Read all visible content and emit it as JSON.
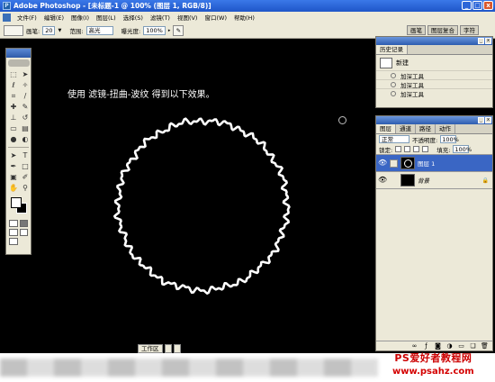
{
  "window": {
    "title": "Adobe Photoshop - [未标题-1 @ 100% (图层 1, RGB/8)]",
    "controls": [
      "_",
      "□",
      "x"
    ]
  },
  "menubar": {
    "items": [
      "文件(F)",
      "编辑(E)",
      "图像(I)",
      "图层(L)",
      "选择(S)",
      "滤镜(T)",
      "视图(V)",
      "窗口(W)",
      "帮助(H)"
    ]
  },
  "options": {
    "brush_label": "画笔:",
    "brush_size": "20",
    "range_label": "范围:",
    "range_value": "高光",
    "exposure_label": "曝光度:",
    "exposure_value": "100%",
    "well_tabs": [
      "画笔",
      "图层复合",
      "字符"
    ]
  },
  "canvas": {
    "caption": "使用 滤镜-扭曲-波纹 得到以下效果。"
  },
  "history": {
    "tabs": [
      "历史记录"
    ],
    "snapshot_label": "新建",
    "items": [
      "加深工具",
      "加深工具",
      "加深工具"
    ]
  },
  "layers": {
    "tabs": [
      "图层",
      "通道",
      "路径",
      "动作"
    ],
    "blend_mode": "正常",
    "opacity_label": "不透明度:",
    "opacity_value": "100%",
    "lock_label": "锁定:",
    "fill_label": "填充:",
    "fill_value": "100%",
    "list": [
      {
        "name": "图层 1",
        "active": true
      },
      {
        "name": "背景",
        "active": false
      }
    ]
  },
  "taskbar": {
    "items": [
      "工作区",
      "",
      ""
    ]
  },
  "watermark": {
    "line1": "PS爱好者教程网",
    "line2": "www.psahz.com"
  },
  "colors": {
    "titlebar": "#2a62d4",
    "panel_bg": "#ece9d8",
    "active_layer": "#3a66c4",
    "watermark": "#cc0000"
  }
}
